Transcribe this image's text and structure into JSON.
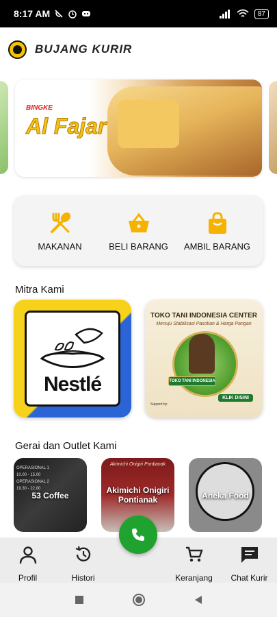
{
  "status_bar": {
    "time": "8:17 AM",
    "battery": "87"
  },
  "app": {
    "title": "BUJANG KURIR"
  },
  "banner": {
    "brand_small": "BINGKE",
    "brand": "Al Fajar"
  },
  "categories": [
    {
      "label": "MAKANAN",
      "icon": "spoon-knife-icon"
    },
    {
      "label": "BELI BARANG",
      "icon": "basket-icon"
    },
    {
      "label": "AMBIL BARANG",
      "icon": "shopping-bag-icon"
    }
  ],
  "partners_section": {
    "title": "Mitra Kami"
  },
  "partners": [
    {
      "name": "Nestlé"
    },
    {
      "title": "TOKO TANI INDONESIA CENTER",
      "subtitle": "Menuju Stabilisasi Pasokan & Harga Pangan",
      "badge": "TOKO TANI INDONESIA",
      "cta": "KLIK DISINI",
      "support": "Support by:"
    }
  ],
  "outlets_section": {
    "title": "Gerai dan Outlet Kami"
  },
  "outlets": [
    {
      "name": "53 Coffee",
      "deco": "OPERASIONAL 1\n10.00 - 15.00\nOPERASIONAL 2\n19.30 - 22.00"
    },
    {
      "name": "Akimichi Onigiri Pontianak",
      "deco": "Akimichi Onigiri Pontianak"
    },
    {
      "name": "Aneka Food"
    }
  ],
  "bottom_nav": [
    {
      "label": "Profil",
      "icon": "person-icon"
    },
    {
      "label": "Histori",
      "icon": "history-icon"
    },
    {
      "label": "Keranjang",
      "icon": "cart-icon"
    },
    {
      "label": "Chat Kurir",
      "icon": "chat-icon"
    }
  ],
  "colors": {
    "accent": "#f5b300",
    "call": "#1fa32e",
    "nav_bg": "#ececec"
  }
}
